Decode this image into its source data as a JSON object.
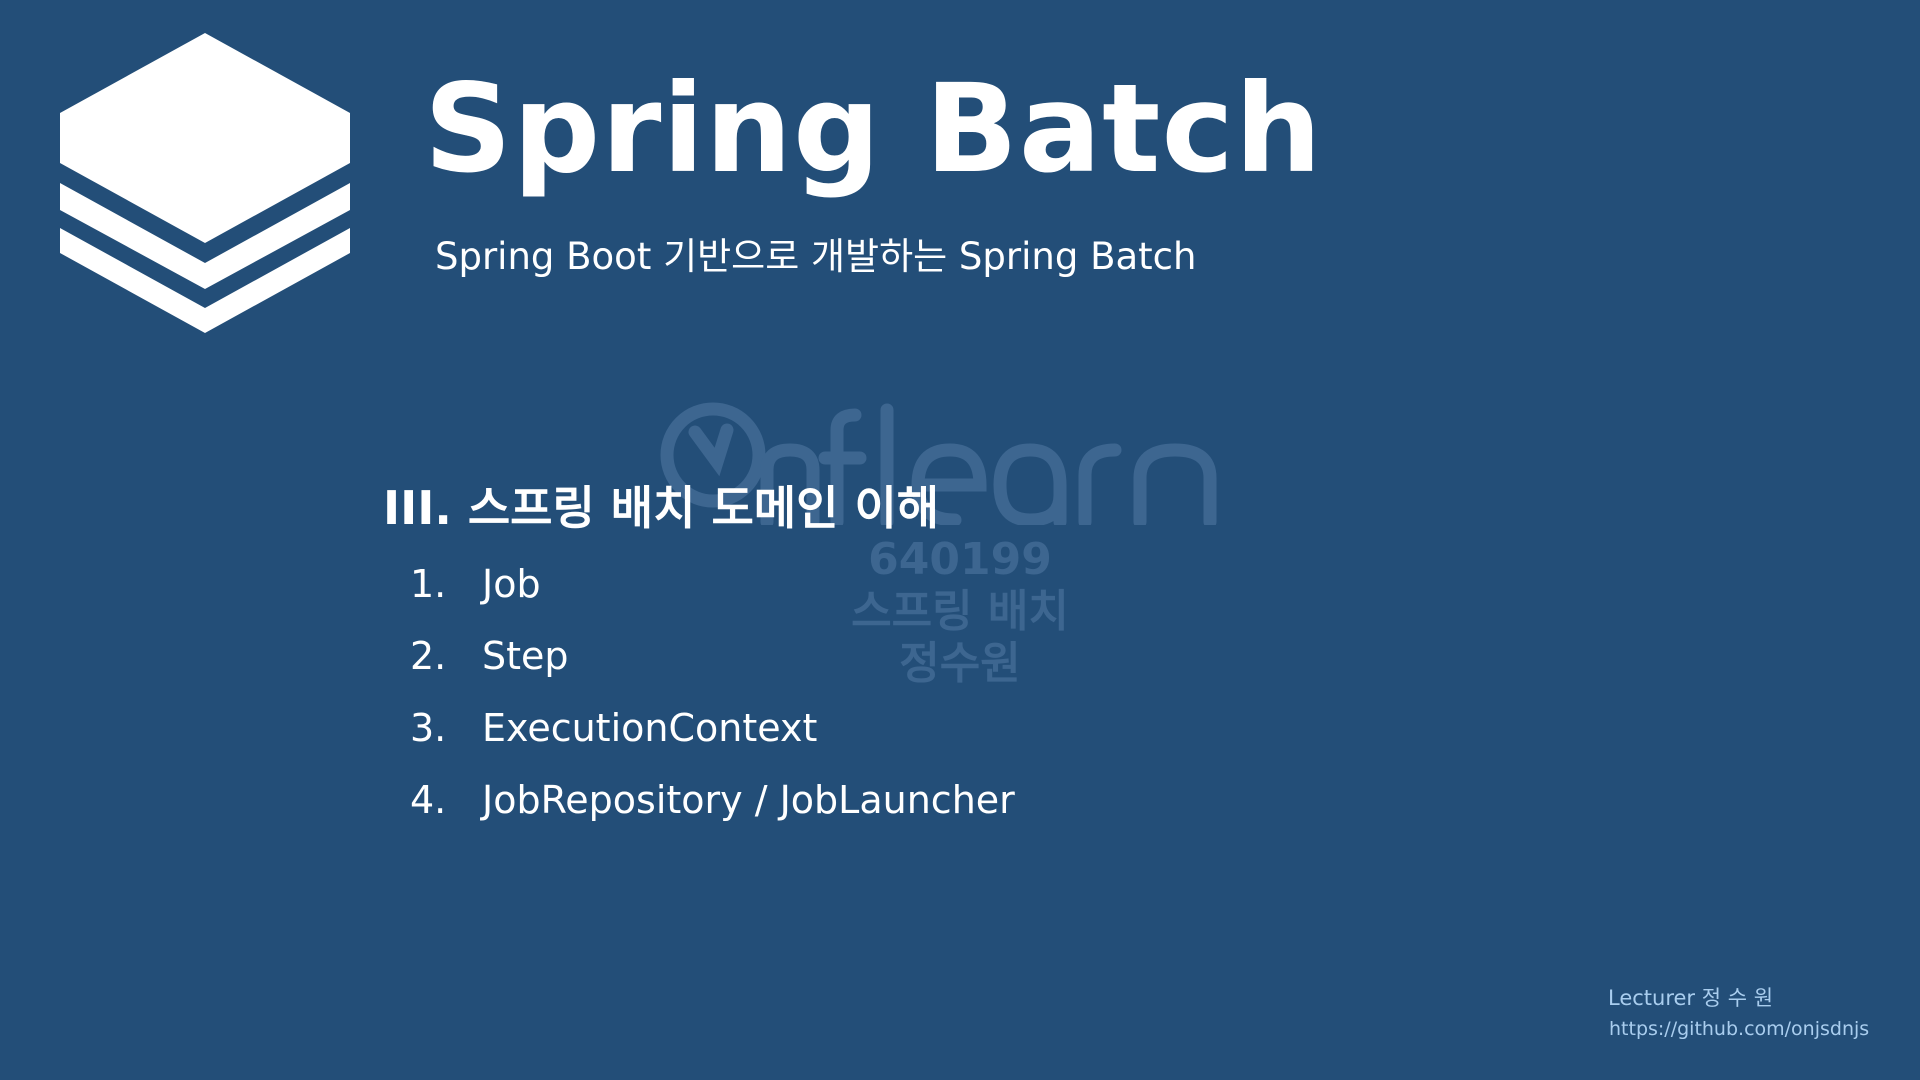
{
  "slide": {
    "title": "Spring Batch",
    "subtitle": "Spring Boot 기반으로 개발하는 Spring Batch",
    "section_heading": "III. 스프링 배치 도메인 이해",
    "items": [
      {
        "num": "1.",
        "label": "Job"
      },
      {
        "num": "2.",
        "label": "Step"
      },
      {
        "num": "3.",
        "label": "ExecutionContext"
      },
      {
        "num": "4.",
        "label": "JobRepository / JobLauncher"
      }
    ]
  },
  "watermark": {
    "brand": "inflearn",
    "course_id": "640199",
    "course_name": "스프링 배치",
    "author": "정수원"
  },
  "footer": {
    "lecturer": "Lecturer 정 수 원",
    "url": "https://github.com/onjsdnjs"
  },
  "colors": {
    "background": "#234e78",
    "watermark": "#3d6690",
    "footer_text": "#a9cdee"
  }
}
